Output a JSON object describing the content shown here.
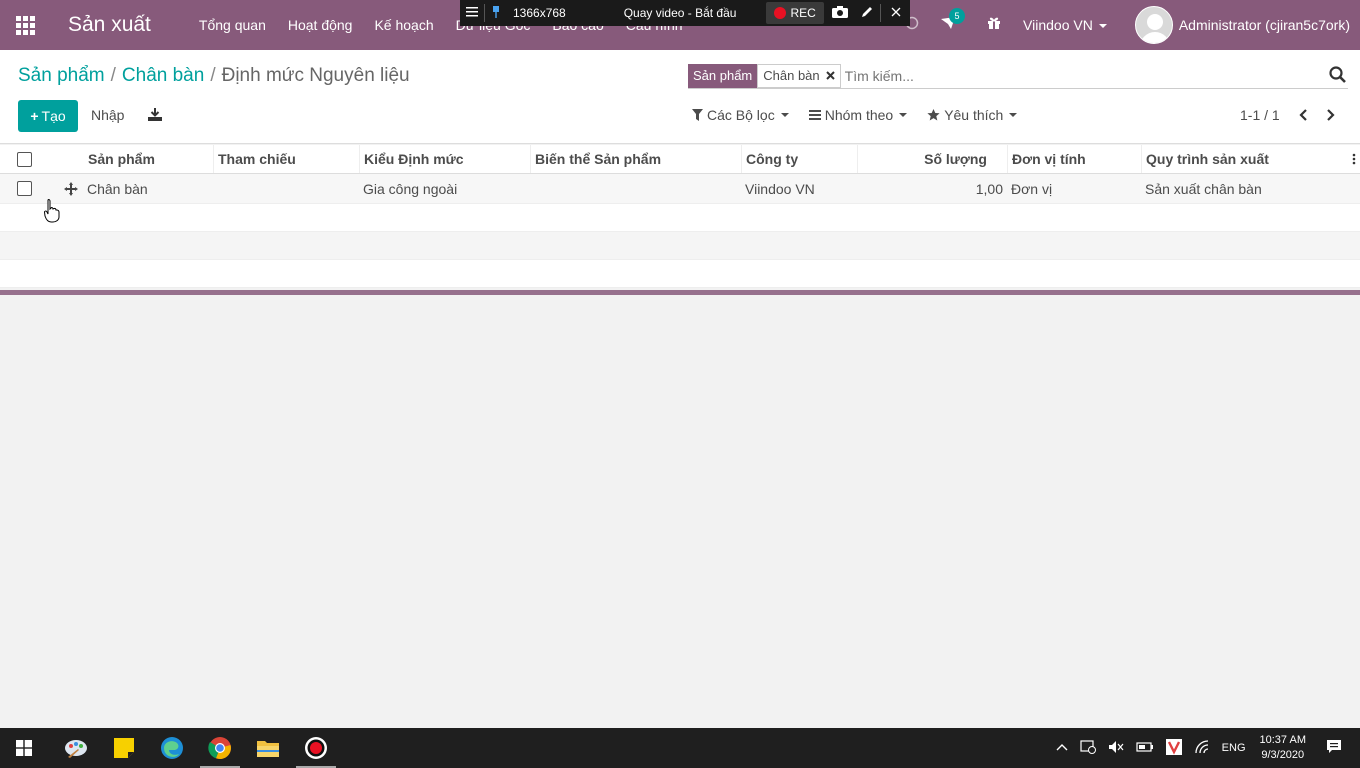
{
  "app": {
    "brand": "Sản xuất",
    "menu": [
      "Tổng quan",
      "Hoạt động",
      "Kế hoạch",
      "Dữ liệu Gốc",
      "Báo cáo",
      "Cấu hình"
    ],
    "notification_count": "5",
    "company": "Viindoo VN",
    "user": "Administrator (cjiran5c7ork)"
  },
  "recorder": {
    "resolution": "1366x768",
    "title": "Quay video - Bắt đầu",
    "rec_label": "REC"
  },
  "breadcrumb": {
    "items": [
      "Sản phẩm",
      "Chân bàn"
    ],
    "current": "Định mức Nguyên liệu"
  },
  "search": {
    "facet_label": "Sản phẩm",
    "facet_value": "Chân bàn",
    "placeholder": "Tìm kiếm..."
  },
  "toolbar": {
    "create_label": "Tạo",
    "import_label": "Nhập",
    "filters_label": "Các Bộ lọc",
    "groupby_label": "Nhóm theo",
    "favorites_label": "Yêu thích",
    "pager": "1-1 / 1"
  },
  "table": {
    "columns": [
      "Sản phẩm",
      "Tham chiếu",
      "Kiểu Định mức",
      "Biến thể Sản phẩm",
      "Công ty",
      "Số lượng",
      "Đơn vị tính",
      "Quy trình sản xuất"
    ],
    "rows": [
      [
        "Chân bàn",
        "",
        "Gia công ngoài",
        "",
        "Viindoo VN",
        "1,00",
        "Đơn vị",
        "Sản xuất chân bàn"
      ]
    ]
  },
  "taskbar": {
    "lang": "ENG",
    "time": "10:37 AM",
    "date": "9/3/2020"
  },
  "colors": {
    "brand": "#875a7b",
    "accent": "#00a09d"
  }
}
